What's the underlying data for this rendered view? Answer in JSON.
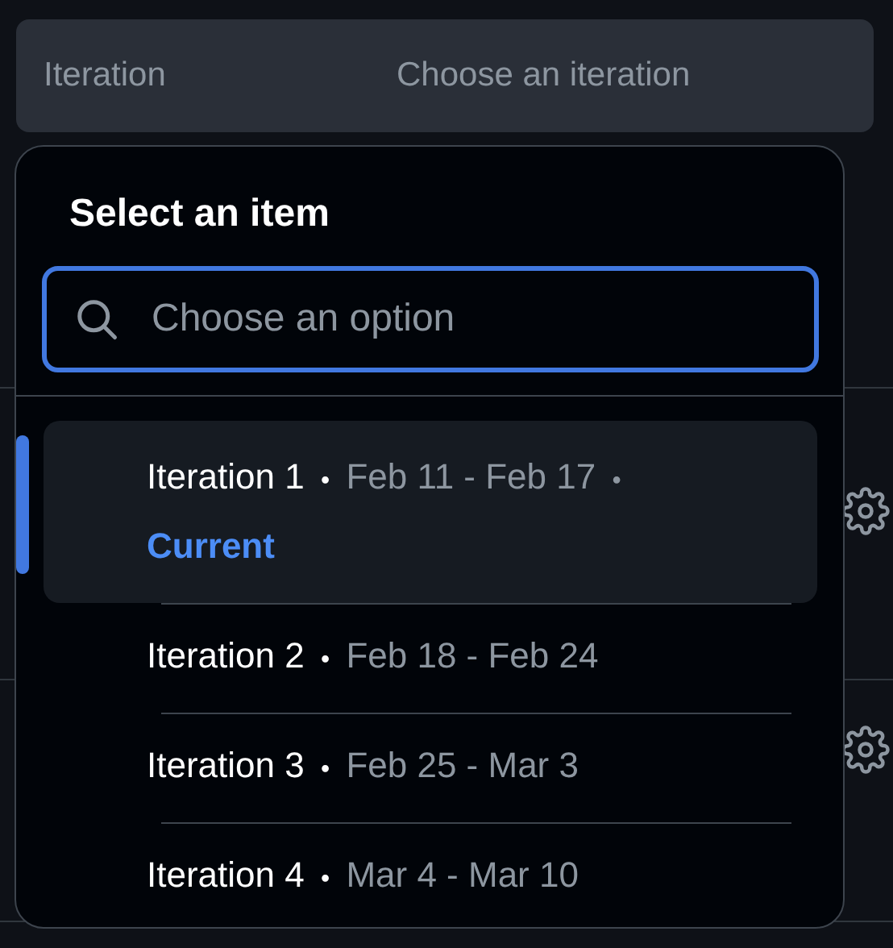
{
  "field": {
    "label": "Iteration",
    "value": "Choose an iteration"
  },
  "dropdown": {
    "title": "Select an item",
    "search": {
      "placeholder": "Choose an option"
    },
    "items": [
      {
        "name": "Iteration 1",
        "separator": "•",
        "dates": "Feb 11 - Feb 17",
        "badge_separator": "•",
        "badge": "Current",
        "selected": true
      },
      {
        "name": "Iteration 2",
        "separator": "•",
        "dates": "Feb 18 - Feb 24",
        "selected": false
      },
      {
        "name": "Iteration 3",
        "separator": "•",
        "dates": "Feb 25 - Mar 3",
        "selected": false
      },
      {
        "name": "Iteration 4",
        "separator": "•",
        "dates": "Mar 4 - Mar 10",
        "selected": false
      }
    ]
  }
}
